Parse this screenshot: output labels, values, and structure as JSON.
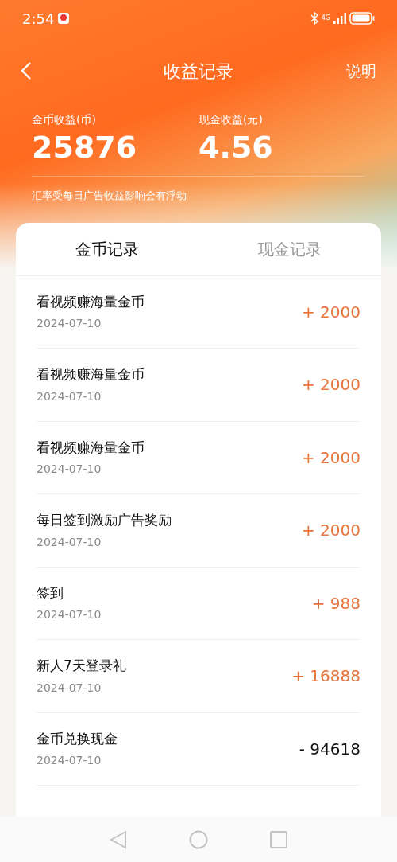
{
  "status_bar": {
    "time": "2:54",
    "network": "4G"
  },
  "header": {
    "title": "收益记录",
    "action": "说明"
  },
  "summary": [
    {
      "label": "金币收益(币)",
      "value": "25876"
    },
    {
      "label": "现金收益(元)",
      "value": "4.56"
    }
  ],
  "note": "汇率受每日广告收益影响会有浮动",
  "tabs": [
    {
      "label": "金币记录",
      "selected": true
    },
    {
      "label": "现金记录",
      "selected": false
    }
  ],
  "records": [
    {
      "title": "看视频赚海量金币",
      "date": "2024-07-10",
      "amount": "+ 2000",
      "kind": "income"
    },
    {
      "title": "看视频赚海量金币",
      "date": "2024-07-10",
      "amount": "+ 2000",
      "kind": "income"
    },
    {
      "title": "看视频赚海量金币",
      "date": "2024-07-10",
      "amount": "+ 2000",
      "kind": "income"
    },
    {
      "title": "每日签到激励广告奖励",
      "date": "2024-07-10",
      "amount": "+ 2000",
      "kind": "income"
    },
    {
      "title": "签到",
      "date": "2024-07-10",
      "amount": "+ 988",
      "kind": "income"
    },
    {
      "title": "新人7天登录礼",
      "date": "2024-07-10",
      "amount": "+ 16888",
      "kind": "income"
    },
    {
      "title": "金币兑换现金",
      "date": "2024-07-10",
      "amount": "- 94618",
      "kind": "expense"
    }
  ]
}
